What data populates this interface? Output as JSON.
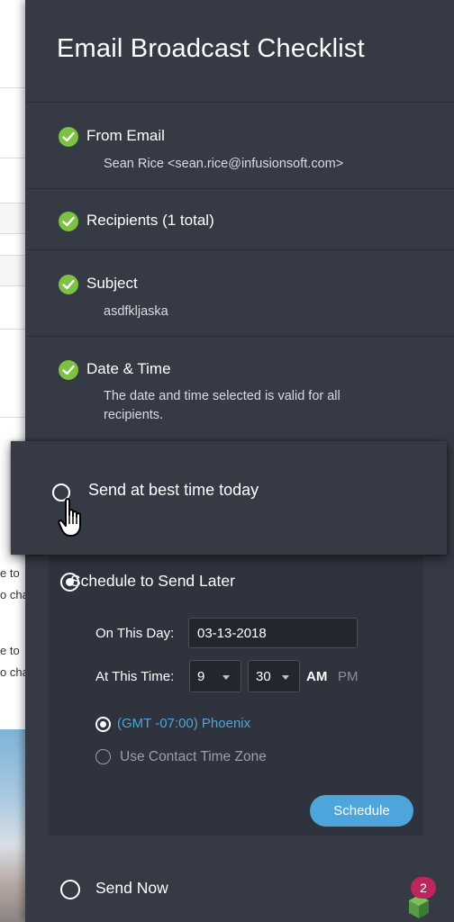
{
  "background": {
    "snippets": [
      "e to",
      "o cha",
      "e to",
      "o cha"
    ]
  },
  "panel": {
    "title": "Email Broadcast Checklist",
    "sections": [
      {
        "title": "From Email",
        "subtitle": "Sean Rice <sean.rice@infusionsoft.com>"
      },
      {
        "title": "Recipients (1 total)"
      },
      {
        "title": "Subject",
        "subtitle": "asdfkljaska"
      },
      {
        "title": "Date & Time",
        "subtitle": "The date and time selected is valid for all recipients."
      }
    ],
    "send_options": {
      "best_time_label": "Send at best time today",
      "schedule_label": "Schedule to Send Later",
      "send_now_label": "Send Now"
    },
    "schedule": {
      "day_label": "On This Day:",
      "date_value": "03-13-2018",
      "time_label": "At This Time:",
      "hour": "9",
      "minute": "30",
      "am": "AM",
      "pm": "PM",
      "selected_period": "AM",
      "timezone_label": "(GMT -07:00) Phoenix",
      "contact_timezone_label": "Use Contact Time Zone",
      "schedule_button": "Schedule"
    },
    "notification_count": "2"
  },
  "colors": {
    "panel_bg": "#353a45",
    "check_green": "#7cc142",
    "accent_blue": "#4ea5dc",
    "badge_pink": "#c0245d"
  }
}
